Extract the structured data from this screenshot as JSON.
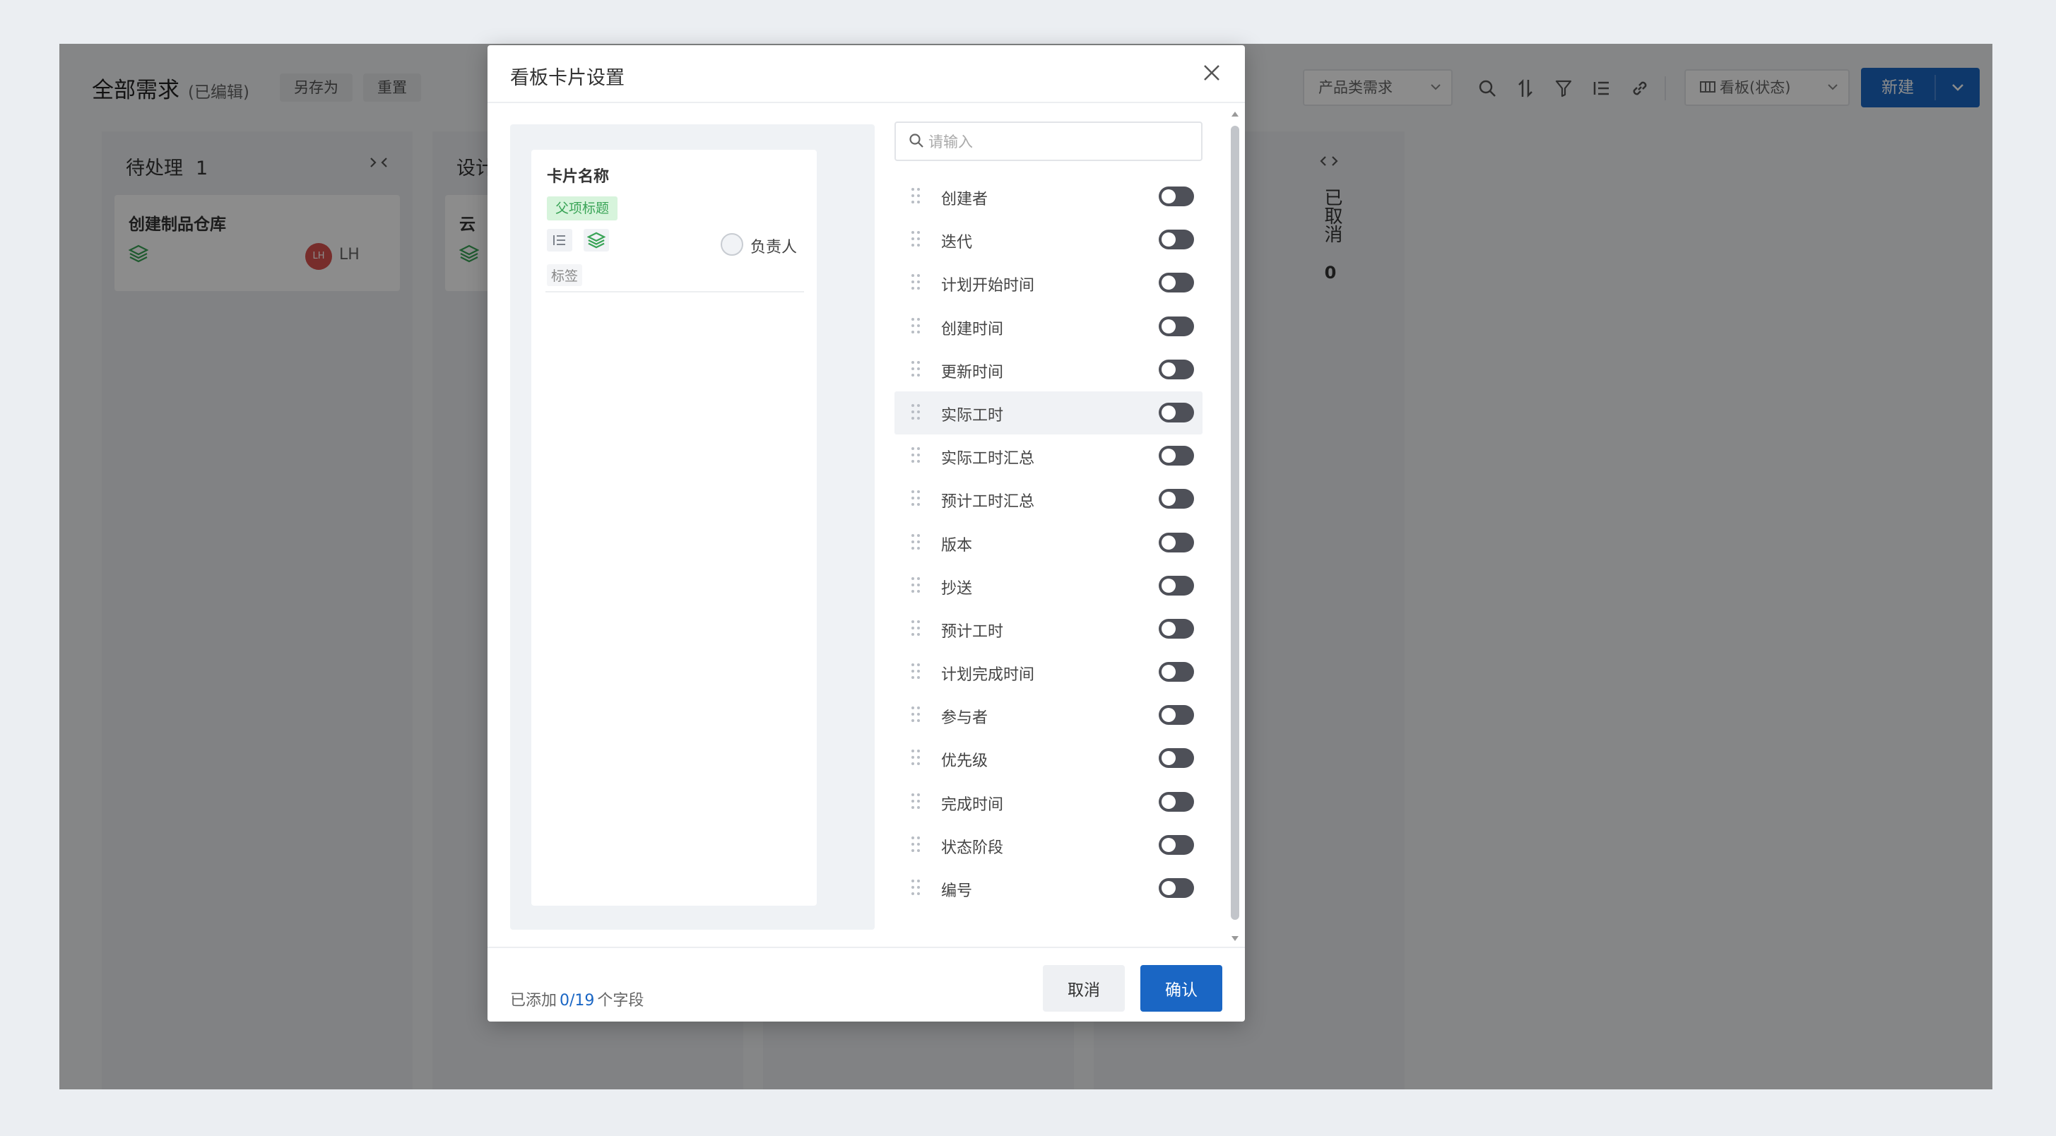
{
  "app": {
    "title": "全部需求",
    "edited_label": "(已编辑)",
    "save_as_label": "另存为",
    "reset_label": "重置",
    "filter_select": "产品类需求",
    "view_select": "看板(状态)",
    "new_label": "新建"
  },
  "board": {
    "columns": [
      {
        "title": "待处理",
        "count": "1",
        "card_title": "创建制品仓库",
        "owner_initials": "LH",
        "owner_name": "LH"
      },
      {
        "title": "设计",
        "card_title": "云"
      }
    ],
    "collapsed_column": {
      "title": "已取消",
      "count": "0"
    }
  },
  "modal": {
    "title": "看板卡片设置",
    "preview": {
      "card_name": "卡片名称",
      "parent_title_tag": "父项标题",
      "owner_label": "负责人",
      "tag_label": "标签"
    },
    "search_placeholder": "请输入",
    "fields": [
      {
        "label": "创建者",
        "enabled": false
      },
      {
        "label": "迭代",
        "enabled": false
      },
      {
        "label": "计划开始时间",
        "enabled": false
      },
      {
        "label": "创建时间",
        "enabled": false
      },
      {
        "label": "更新时间",
        "enabled": false
      },
      {
        "label": "实际工时",
        "enabled": false,
        "hovered": true
      },
      {
        "label": "实际工时汇总",
        "enabled": false
      },
      {
        "label": "预计工时汇总",
        "enabled": false
      },
      {
        "label": "版本",
        "enabled": false
      },
      {
        "label": "抄送",
        "enabled": false
      },
      {
        "label": "预计工时",
        "enabled": false
      },
      {
        "label": "计划完成时间",
        "enabled": false
      },
      {
        "label": "参与者",
        "enabled": false
      },
      {
        "label": "优先级",
        "enabled": false
      },
      {
        "label": "完成时间",
        "enabled": false
      },
      {
        "label": "状态阶段",
        "enabled": false
      },
      {
        "label": "编号",
        "enabled": false
      }
    ],
    "footer": {
      "added_prefix": "已添加",
      "added_count": "0/19",
      "added_suffix": "个字段",
      "cancel_label": "取消",
      "confirm_label": "确认"
    }
  },
  "colors": {
    "primary": "#1a66c4",
    "tag_green_bg": "#d7f4dc",
    "tag_green_text": "#3aa457",
    "switch_off": "#4e5058",
    "avatar_red": "#d9534f"
  },
  "icons": {
    "close": "close-icon",
    "search": "search-icon",
    "sort": "sort-icon",
    "filter": "filter-icon",
    "list": "list-icon",
    "link": "link-icon",
    "board_view": "board-view-icon",
    "layers": "layers-icon",
    "drag": "drag-handle-icon"
  }
}
